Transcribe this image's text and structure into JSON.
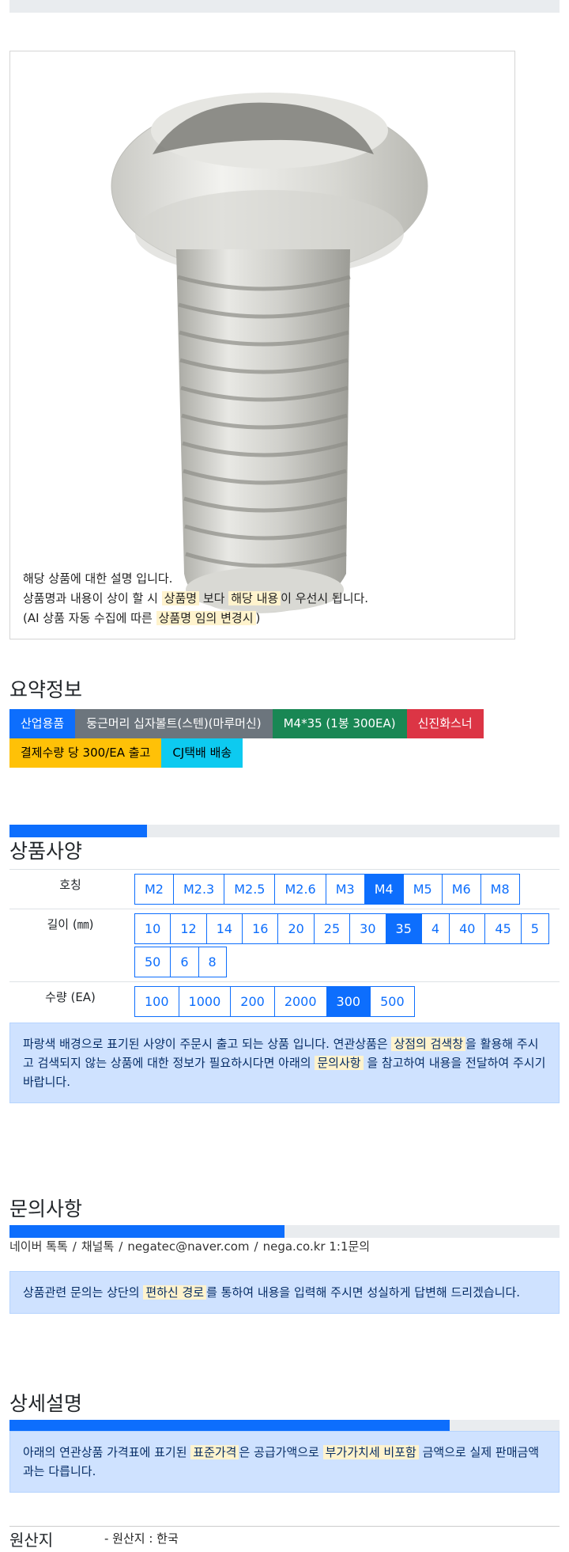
{
  "description": {
    "line1": "해당 상품에 대한 설명 입니다.",
    "line2_a": "상품명과 내용이 상이 할 시 ",
    "line2_hl1": "상품명",
    "line2_b": " 보다 ",
    "line2_hl2": "해당 내용",
    "line2_c": "이 우선시 됩니다.",
    "line3_a": "(AI 상품 자동 수집에 따른 ",
    "line3_hl": "상품명 임의 변경시",
    "line3_b": ")"
  },
  "summary": {
    "title": "요약정보",
    "badges": [
      "산업용품",
      "둥근머리 십자볼트(스텐)(마루머신)",
      "M4*35 (1봉 300EA)",
      "신진화스너",
      "결제수량 당 300/EA 출고",
      "CJ택배 배송"
    ]
  },
  "spec": {
    "title": "상품사양",
    "progress": 0.25,
    "rows": [
      {
        "label": "호칭",
        "options": [
          "M2",
          "M2.3",
          "M2.5",
          "M2.6",
          "M3",
          "M4",
          "M5",
          "M6",
          "M8"
        ],
        "selected": "M4"
      },
      {
        "label": "길이 (㎜)",
        "options": [
          "10",
          "12",
          "14",
          "16",
          "20",
          "25",
          "30",
          "35",
          "4",
          "40",
          "45",
          "5",
          "50",
          "6",
          "8"
        ],
        "selected": "35"
      },
      {
        "label": "수량 (EA)",
        "options": [
          "100",
          "1000",
          "200",
          "2000",
          "300",
          "500"
        ],
        "selected": "300"
      }
    ],
    "notice_a": "파랑색 배경으로 표기된 사양이 주문시 출고 되는 상품 입니다. 연관상품은 ",
    "notice_hl1": "상점의 검색창",
    "notice_b": "을 활용해 주시고 검색되지 않는 상품에 대한 정보가 필요하시다면 아래의 ",
    "notice_hl2": "문의사항",
    "notice_c": " 을 참고하여 내용을 전달하여 주시기 바랍니다."
  },
  "inquiry": {
    "title": "문의사항",
    "progress": 0.5,
    "links": [
      "네이버 톡톡",
      "채널톡",
      "negatec@naver.com",
      "nega.co.kr 1:1문의"
    ],
    "notice_a": "상품관련 문의는 상단의 ",
    "notice_hl": "편하신 경로",
    "notice_b": "를 통하여 내용을 입력해 주시면 성실하게 답변해 드리겠습니다."
  },
  "detail": {
    "title": "상세설명",
    "progress": 0.8,
    "notice_a": "아래의 연관상품 가격표에 표기된 ",
    "notice_hl1": "표준가격",
    "notice_b": "은 공급가액으로 ",
    "notice_hl2": "부가가치세 비포함",
    "notice_c": " 금액으로 실제 판매금액과는 다릅니다."
  },
  "origin": {
    "label": "원산지",
    "value": "- 원산지 : 한국"
  },
  "colors": {
    "primary": "#0d6efd",
    "alert_bg": "#cfe2ff",
    "highlight": "#fff3cd"
  }
}
